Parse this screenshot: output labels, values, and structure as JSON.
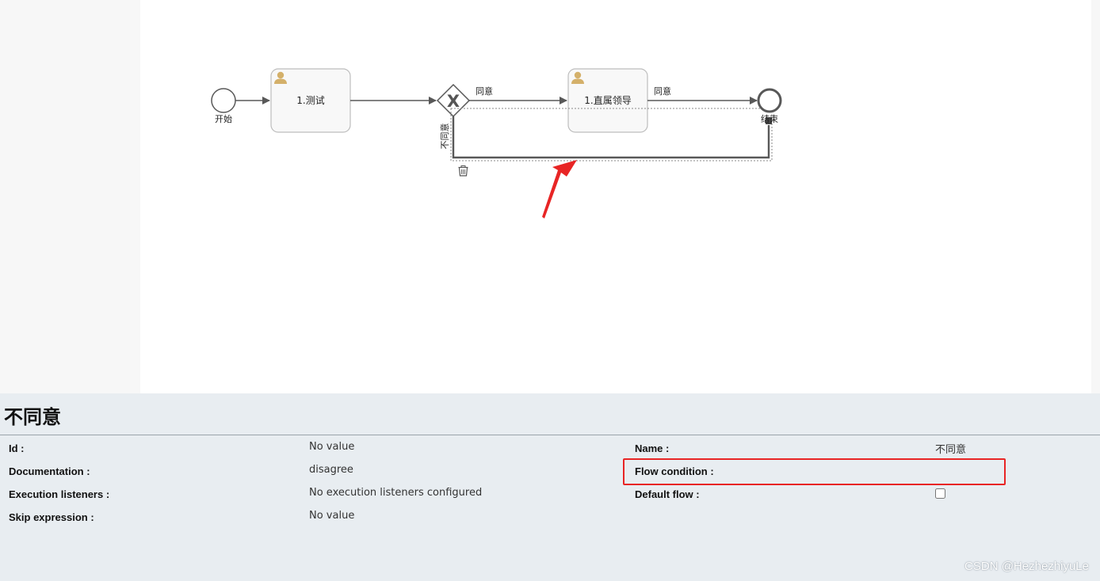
{
  "diagram": {
    "start_label": "开始",
    "task1_label": "1.测试",
    "task2_label": "1.直属领导",
    "flow_agree_label_1": "同意",
    "flow_agree_label_2": "同意",
    "flow_disagree_label": "不同意",
    "end_label": "结束",
    "gateway_symbol": "X"
  },
  "properties": {
    "title": "不同意",
    "fields": {
      "id_label": "Id :",
      "id_value": "No value",
      "documentation_label": "Documentation :",
      "documentation_value": "disagree",
      "execution_listeners_label": "Execution listeners :",
      "execution_listeners_value": "No execution listeners configured",
      "skip_expression_label": "Skip expression :",
      "skip_expression_value": "No value",
      "name_label": "Name :",
      "name_value": "不同意",
      "flow_condition_label": "Flow condition :",
      "default_flow_label": "Default flow :",
      "default_flow_checked": false
    }
  },
  "watermark": "CSDN @HezhezhiyuLe",
  "colors": {
    "highlight": "#e82525",
    "annotation_arrow": "#e82525",
    "user_icon": "#d4b06a",
    "panel_bg": "#e8edf1"
  }
}
